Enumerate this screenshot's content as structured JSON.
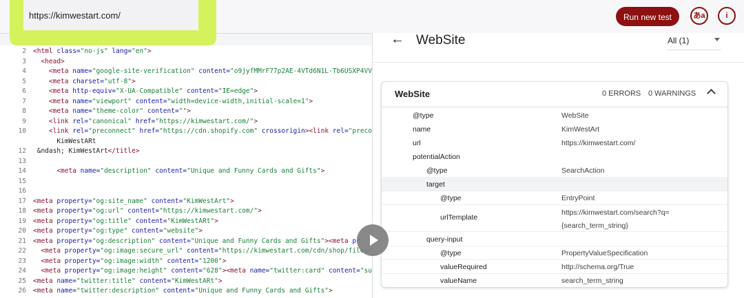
{
  "header": {
    "url": "https://kimwestart.com/",
    "run_button": "Run new test",
    "lang_button": "あa",
    "info_button": "i"
  },
  "code": [
    {
      "n": "2",
      "segs": [
        [
          "tag",
          "<html "
        ],
        [
          "attr",
          "class="
        ],
        [
          "val",
          "\"no-js\" "
        ],
        [
          "attr",
          "lang="
        ],
        [
          "val",
          "\"en\""
        ],
        [
          "tag",
          ">"
        ]
      ]
    },
    {
      "n": "3",
      "segs": [
        [
          "txt",
          "  "
        ],
        [
          "tag",
          "<head>"
        ]
      ]
    },
    {
      "n": "4",
      "segs": [
        [
          "txt",
          "    "
        ],
        [
          "tag",
          "<meta "
        ],
        [
          "attr",
          "name="
        ],
        [
          "val",
          "\"google-site-verification\" "
        ],
        [
          "attr",
          "content="
        ],
        [
          "val",
          "\"o9jyfMMrF77p2AE-4VTd6N1L-Tb6USXP4VVI"
        ]
      ]
    },
    {
      "n": "5",
      "segs": [
        [
          "txt",
          "    "
        ],
        [
          "tag",
          "<meta "
        ],
        [
          "attr",
          "charset="
        ],
        [
          "val",
          "\"utf-8\""
        ],
        [
          "tag",
          ">"
        ]
      ]
    },
    {
      "n": "6",
      "segs": [
        [
          "txt",
          "    "
        ],
        [
          "tag",
          "<meta "
        ],
        [
          "attr",
          "http-equiv="
        ],
        [
          "val",
          "\"X-UA-Compatible\" "
        ],
        [
          "attr",
          "content="
        ],
        [
          "val",
          "\"IE=edge\""
        ],
        [
          "tag",
          ">"
        ]
      ]
    },
    {
      "n": "7",
      "segs": [
        [
          "txt",
          "    "
        ],
        [
          "tag",
          "<meta "
        ],
        [
          "attr",
          "name="
        ],
        [
          "val",
          "\"viewport\" "
        ],
        [
          "attr",
          "content="
        ],
        [
          "val",
          "\"width=device-width,initial-scale=1\""
        ],
        [
          "tag",
          ">"
        ]
      ]
    },
    {
      "n": "8",
      "segs": [
        [
          "txt",
          "    "
        ],
        [
          "tag",
          "<meta "
        ],
        [
          "attr",
          "name="
        ],
        [
          "val",
          "\"theme-color\" "
        ],
        [
          "attr",
          "content="
        ],
        [
          "val",
          "\"\""
        ],
        [
          "tag",
          ">"
        ]
      ]
    },
    {
      "n": "9",
      "segs": [
        [
          "txt",
          "    "
        ],
        [
          "tag",
          "<link "
        ],
        [
          "attr",
          "rel="
        ],
        [
          "val",
          "\"canonical\" "
        ],
        [
          "attr",
          "href="
        ],
        [
          "val",
          "\"https://kimwestart.com/\""
        ],
        [
          "tag",
          ">"
        ]
      ]
    },
    {
      "n": "10",
      "segs": [
        [
          "txt",
          "    "
        ],
        [
          "tag",
          "<link "
        ],
        [
          "attr",
          "rel="
        ],
        [
          "val",
          "\"preconnect\" "
        ],
        [
          "attr",
          "href="
        ],
        [
          "val",
          "\"https://cdn.shopify.com\" "
        ],
        [
          "attr",
          "crossorigin"
        ],
        [
          "tag",
          ">"
        ],
        [
          "tag",
          "<link "
        ],
        [
          "attr",
          "rel="
        ],
        [
          "val",
          "\"precon"
        ]
      ]
    },
    {
      "n": "",
      "segs": [
        [
          "txt",
          "      KimWestARt"
        ]
      ]
    },
    {
      "n": "12",
      "segs": [
        [
          "txt",
          " &ndash; KimWestArt"
        ],
        [
          "tag",
          "</title>"
        ]
      ]
    },
    {
      "n": "13",
      "segs": []
    },
    {
      "n": "14",
      "segs": [
        [
          "txt",
          "      "
        ],
        [
          "tag",
          "<meta "
        ],
        [
          "attr",
          "name="
        ],
        [
          "val",
          "\"description\" "
        ],
        [
          "attr",
          "content="
        ],
        [
          "val",
          "\"Unique and Funny Cards and Gifts\""
        ],
        [
          "tag",
          ">"
        ]
      ]
    },
    {
      "n": "15",
      "segs": []
    },
    {
      "n": "16",
      "segs": []
    },
    {
      "n": "17",
      "segs": [
        [
          "tag",
          "<meta "
        ],
        [
          "attr",
          "property="
        ],
        [
          "val",
          "\"og:site_name\" "
        ],
        [
          "attr",
          "content="
        ],
        [
          "val",
          "\"KimWestArt\""
        ],
        [
          "tag",
          ">"
        ]
      ]
    },
    {
      "n": "18",
      "segs": [
        [
          "tag",
          "<meta "
        ],
        [
          "attr",
          "property="
        ],
        [
          "val",
          "\"og:url\" "
        ],
        [
          "attr",
          "content="
        ],
        [
          "val",
          "\"https://kimwestart.com/\""
        ],
        [
          "tag",
          ">"
        ]
      ]
    },
    {
      "n": "19",
      "segs": [
        [
          "tag",
          "<meta "
        ],
        [
          "attr",
          "property="
        ],
        [
          "val",
          "\"og:title\" "
        ],
        [
          "attr",
          "content="
        ],
        [
          "val",
          "\"KimWestARt\""
        ],
        [
          "tag",
          ">"
        ]
      ]
    },
    {
      "n": "20",
      "segs": [
        [
          "tag",
          "<meta "
        ],
        [
          "attr",
          "property="
        ],
        [
          "val",
          "\"og:type\" "
        ],
        [
          "attr",
          "content="
        ],
        [
          "val",
          "\"website\""
        ],
        [
          "tag",
          ">"
        ]
      ]
    },
    {
      "n": "21",
      "segs": [
        [
          "tag",
          "<meta "
        ],
        [
          "attr",
          "property="
        ],
        [
          "val",
          "\"og:description\" "
        ],
        [
          "attr",
          "content="
        ],
        [
          "val",
          "\"Unique and Funny Cards and Gifts\""
        ],
        [
          "tag",
          ">"
        ],
        [
          "tag",
          "<meta "
        ],
        [
          "attr",
          "pr"
        ]
      ]
    },
    {
      "n": "22",
      "segs": [
        [
          "txt",
          "  "
        ],
        [
          "tag",
          "<meta "
        ],
        [
          "attr",
          "property="
        ],
        [
          "val",
          "\"og:image:secure_url\" "
        ],
        [
          "attr",
          "content="
        ],
        [
          "val",
          "\"https://kimwestart.com/cdn/shop/files/"
        ]
      ]
    },
    {
      "n": "23",
      "segs": [
        [
          "txt",
          "  "
        ],
        [
          "tag",
          "<meta "
        ],
        [
          "attr",
          "property="
        ],
        [
          "val",
          "\"og:image:width\" "
        ],
        [
          "attr",
          "content="
        ],
        [
          "val",
          "\"1200\""
        ],
        [
          "tag",
          ">"
        ]
      ]
    },
    {
      "n": "24",
      "segs": [
        [
          "txt",
          "  "
        ],
        [
          "tag",
          "<meta "
        ],
        [
          "attr",
          "property="
        ],
        [
          "val",
          "\"og:image:height\" "
        ],
        [
          "attr",
          "content="
        ],
        [
          "val",
          "\"628\""
        ],
        [
          "tag",
          ">"
        ],
        [
          "tag",
          "<meta "
        ],
        [
          "attr",
          "name="
        ],
        [
          "val",
          "\"twitter:card\" "
        ],
        [
          "attr",
          "content="
        ],
        [
          "val",
          "\"sum"
        ]
      ]
    },
    {
      "n": "25",
      "segs": [
        [
          "tag",
          "<meta "
        ],
        [
          "attr",
          "name="
        ],
        [
          "val",
          "\"twitter:title\" "
        ],
        [
          "attr",
          "content="
        ],
        [
          "val",
          "\"KimWestARt\""
        ],
        [
          "tag",
          ">"
        ]
      ]
    },
    {
      "n": "26",
      "segs": [
        [
          "tag",
          "<meta "
        ],
        [
          "attr",
          "name="
        ],
        [
          "val",
          "\"twitter:description\" "
        ],
        [
          "attr",
          "content="
        ],
        [
          "val",
          "\"Unique and Funny Cards and Gifts\""
        ],
        [
          "tag",
          ">"
        ]
      ]
    }
  ],
  "panel": {
    "title": "WebSite",
    "filter": "All (1)"
  },
  "card": {
    "title": "WebSite",
    "errors": "0 ERRORS",
    "warnings": "0 WARNINGS",
    "props": [
      {
        "key": "@type",
        "value": "WebSite",
        "indent": 0,
        "bold": false
      },
      {
        "key": "name",
        "value": "KimWestArt",
        "indent": 0,
        "bold": false
      },
      {
        "key": "url",
        "value": "https://kimwestart.com/",
        "indent": 0,
        "bold": false
      },
      {
        "key": "potentialAction",
        "value": "",
        "indent": 0,
        "bold": false
      },
      {
        "key": "@type",
        "value": "SearchAction",
        "indent": 1,
        "bold": false
      },
      {
        "key": "target",
        "value": "",
        "indent": 1,
        "bold": false,
        "highlight": true
      },
      {
        "key": "@type",
        "value": "EntryPoint",
        "indent": 2,
        "bold": false
      },
      {
        "key": "urlTemplate",
        "value": "https://kimwestart.com/search?q=",
        "value2": "{search_term_string}",
        "indent": 2,
        "bold": false,
        "tall": true
      },
      {
        "key": "query-input",
        "value": "",
        "indent": 1,
        "bold": false
      },
      {
        "key": "@type",
        "value": "PropertyValueSpecification",
        "indent": 2,
        "bold": false
      },
      {
        "key": "valueRequired",
        "value": "http://schema.org/True",
        "indent": 2,
        "bold": false
      },
      {
        "key": "valueName",
        "value": "search_term_string",
        "indent": 2,
        "bold": false
      }
    ]
  }
}
